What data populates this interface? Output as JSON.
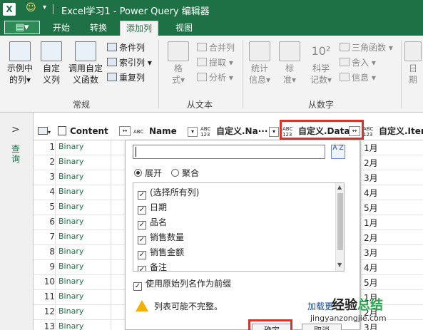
{
  "titlebar": {
    "logo": "X",
    "title": "Excel学习1 - Power Query 编辑器"
  },
  "tabs": {
    "file_label": "▤▾",
    "items": [
      "开始",
      "转换",
      "添加列",
      "视图"
    ],
    "active": "添加列"
  },
  "ribbon": {
    "big_buttons": [
      {
        "label1": "示例中",
        "label2": "的列▾"
      },
      {
        "label1": "自定",
        "label2": "义列"
      },
      {
        "label1": "调用自定",
        "label2": "义函数"
      },
      {
        "label1": "格",
        "label2": "式▾"
      },
      {
        "label1": "统计",
        "label2": "信息▾"
      },
      {
        "label1": "标",
        "label2": "准▾"
      },
      {
        "label1": "科学",
        "label2": "记数▾"
      },
      {
        "label1": "日",
        "label2": "期"
      }
    ],
    "small_buttons": [
      {
        "label": "条件列"
      },
      {
        "label": "索引列 ▾"
      },
      {
        "label": "重复列"
      },
      {
        "label": "合并列"
      },
      {
        "label": "提取 ▾"
      },
      {
        "label": "分析 ▾"
      },
      {
        "label": "三角函数 ▾"
      },
      {
        "label": "舍入 ▾"
      },
      {
        "label": "信息 ▾"
      }
    ],
    "sci_number": "10²",
    "groups": [
      "常规",
      "从文本",
      "从数字"
    ]
  },
  "left_pane": {
    "label": "查询"
  },
  "grid": {
    "headers": {
      "content": "Content",
      "name": "Name",
      "custom_name": "自定义.Na···",
      "custom_data": "自定义.Data",
      "custom_item": "自定义.Item"
    },
    "type_labels": {
      "abc": "ABC",
      "n123": "123"
    },
    "rows": [
      {
        "num": "1",
        "content": "Binary",
        "month": "1月"
      },
      {
        "num": "2",
        "content": "Binary",
        "month": "2月"
      },
      {
        "num": "3",
        "content": "Binary",
        "month": "3月"
      },
      {
        "num": "4",
        "content": "Binary",
        "month": "4月"
      },
      {
        "num": "5",
        "content": "Binary",
        "month": "5月"
      },
      {
        "num": "6",
        "content": "Binary",
        "month": "1月"
      },
      {
        "num": "7",
        "content": "Binary",
        "month": "2月"
      },
      {
        "num": "8",
        "content": "Binary",
        "month": "3月"
      },
      {
        "num": "9",
        "content": "Binary",
        "month": "4月"
      },
      {
        "num": "10",
        "content": "Binary",
        "month": "5月"
      },
      {
        "num": "11",
        "content": "Binary",
        "month": "1月"
      },
      {
        "num": "12",
        "content": "Binary",
        "month": "2月"
      },
      {
        "num": "13",
        "content": "Binary",
        "month": "3月"
      }
    ]
  },
  "dialog": {
    "sort_icon": "A Z",
    "radio_expand": "展开",
    "radio_aggregate": "聚合",
    "columns": [
      {
        "label": "(选择所有列)",
        "checked": true
      },
      {
        "label": "日期",
        "checked": true
      },
      {
        "label": "品名",
        "checked": true
      },
      {
        "label": "销售数量",
        "checked": true
      },
      {
        "label": "销售金额",
        "checked": true
      },
      {
        "label": "备注",
        "checked": true
      }
    ],
    "prefix_label": "使用原始列名作为前缀",
    "warning": "列表可能不完整。",
    "load_more": "加载更",
    "ok_label": "确定",
    "cancel_label": "取消"
  },
  "watermark": {
    "brand_a": "经验",
    "brand_b": "总结",
    "url": "jingyanzongjie.com"
  },
  "colors": {
    "brand": "#1e7145",
    "highlight": "#d9342b"
  }
}
